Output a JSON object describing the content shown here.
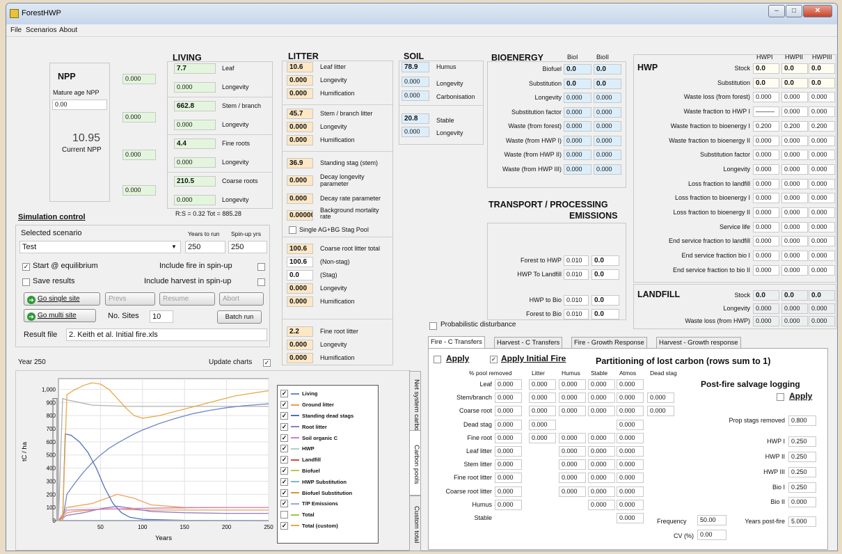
{
  "window": {
    "title": "ForestHWP",
    "min": "–",
    "max": "□",
    "close": "✕"
  },
  "menu": [
    "File",
    "Scenarios",
    "About"
  ],
  "npp": {
    "heading": "NPP",
    "mature_label": "Mature age NPP",
    "mature_value": "0.00",
    "current_value": "10.95",
    "current_label": "Current NPP",
    "alloc": [
      "0.000",
      "0.000",
      "0.000",
      "0.000"
    ]
  },
  "living": {
    "heading": "LIVING",
    "rows": [
      {
        "value": "7.7",
        "label": "Leaf",
        "longevity": "0.000",
        "longevity_label": "Longevity"
      },
      {
        "value": "662.8",
        "label": "Stem / branch",
        "longevity": "0.000",
        "longevity_label": "Longevity"
      },
      {
        "value": "4.4",
        "label": "Fine roots",
        "longevity": "0.000",
        "longevity_label": "Longevity"
      },
      {
        "value": "210.5",
        "label": "Coarse roots",
        "longevity": "0.000",
        "longevity_label": "Longevity"
      }
    ],
    "footer": "R:S = 0.32  Tot = 885.28"
  },
  "litter": {
    "heading": "LITTER",
    "leaf": {
      "value": "10.6",
      "label": "Leaf litter",
      "longevity": "0.000",
      "longevity_label": "Longevity",
      "humification": "0.000",
      "humification_label": "Humification"
    },
    "stem": {
      "value": "45.7",
      "label": "Stem / branch litter",
      "longevity": "0.000",
      "longevity_label": "Longevity",
      "humification": "0.000",
      "humification_label": "Humification"
    },
    "stag": {
      "value": "36.9",
      "label": "Standing stag (stem)",
      "decay_longevity": "0.000",
      "decay_longevity_label": "Decay longevity parameter",
      "decay_rate": "0.000",
      "decay_rate_label": "Decay rate parameter",
      "background": "0.00000",
      "background_label": "Background mortality rate",
      "single_pool_label": "Single AG+BG Stag Pool"
    },
    "coarse": {
      "total": "100.6",
      "total_label": "Coarse root litter total",
      "nonstag": "100.6",
      "nonstag_label": "(Non-stag)",
      "stag": "0.0",
      "stag_label": "(Stag)",
      "longevity": "0.000",
      "longevity_label": "Longevity",
      "humification": "0.000",
      "humification_label": "Humification"
    },
    "fine": {
      "value": "2.2",
      "label": "Fine root litter",
      "longevity": "0.000",
      "longevity_label": "Longevity",
      "humification": "0.000",
      "humification_label": "Humification"
    }
  },
  "soil": {
    "heading": "SOIL",
    "humus": {
      "value": "78.9",
      "label": "Humus",
      "longevity": "0.000",
      "longevity_label": "Longevity",
      "carbonisation": "0.000",
      "carbonisation_label": "Carbonisation"
    },
    "stable": {
      "value": "20.8",
      "label": "Stable",
      "longevity": "0.000",
      "longevity_label": "Longevity"
    }
  },
  "bioenergy": {
    "heading": "BIOENERGY",
    "col1": "BioI",
    "col2": "BioII",
    "rows": [
      {
        "label": "Biofuel",
        "a": "0.0",
        "b": "0.0"
      },
      {
        "label": "Substitution",
        "a": "0.0",
        "b": "0.0"
      },
      {
        "label": "Longevity",
        "a": "0.000",
        "b": "0.000"
      },
      {
        "label": "Substitution factor",
        "a": "0.000",
        "b": "0.000"
      },
      {
        "label": "Waste (from forest)",
        "a": "0.000",
        "b": "0.000"
      },
      {
        "label": "Waste (from HWP I)",
        "a": "0.000",
        "b": "0.000"
      },
      {
        "label": "Waste (from HWP II)",
        "a": "0.000",
        "b": "0.000"
      },
      {
        "label": "Waste (from HWP III)",
        "a": "0.000",
        "b": "0.000"
      }
    ]
  },
  "transport": {
    "heading1": "TRANSPORT / PROCESSING",
    "heading2": "EMISSIONS",
    "rows": [
      {
        "label": "Forest to HWP",
        "a": "0.010",
        "b": "0.0"
      },
      {
        "label": "HWP To Landfill",
        "a": "0.010",
        "b": "0.0"
      },
      {
        "label": "HWP to Bio",
        "a": "0.010",
        "b": "0.0"
      },
      {
        "label": "Forest to Bio",
        "a": "0.010",
        "b": "0.0"
      }
    ]
  },
  "hwp": {
    "heading": "HWP",
    "cols": [
      "HWPI",
      "HWPII",
      "HWPIII"
    ],
    "rows": [
      {
        "label": "Stock",
        "v": [
          "0.0",
          "0.0",
          "0.0"
        ]
      },
      {
        "label": "Substitution",
        "v": [
          "0.0",
          "0.0",
          "0.0"
        ]
      },
      {
        "label": "Waste loss (from forest)",
        "v": [
          "0.000",
          "0.000",
          "0.000"
        ]
      },
      {
        "label": "Waste fraction to HWP I",
        "v": [
          "———",
          "0.000",
          "0.000"
        ]
      },
      {
        "label": "Waste fraction to bioenergy I",
        "v": [
          "0.200",
          "0.200",
          "0.200"
        ]
      },
      {
        "label": "Waste fraction to bioenergy II",
        "v": [
          "0.000",
          "0.000",
          "0.000"
        ]
      },
      {
        "label": "Substitution factor",
        "v": [
          "0.000",
          "0.000",
          "0.000"
        ]
      },
      {
        "label": "Longevity",
        "v": [
          "0.000",
          "0.000",
          "0.000"
        ]
      },
      {
        "label": "Loss fraction to landfill",
        "v": [
          "0.000",
          "0.000",
          "0.000"
        ]
      },
      {
        "label": "Loss fraction to bioenergy I",
        "v": [
          "0.000",
          "0.000",
          "0.000"
        ]
      },
      {
        "label": "Loss fraction to bioenergy II",
        "v": [
          "0.000",
          "0.000",
          "0.000"
        ]
      },
      {
        "label": "Service life",
        "v": [
          "0.000",
          "0.000",
          "0.000"
        ]
      },
      {
        "label": "End service fraction to landfill",
        "v": [
          "0.000",
          "0.000",
          "0.000"
        ]
      },
      {
        "label": "End service fraction bio I",
        "v": [
          "0.000",
          "0.000",
          "0.000"
        ]
      },
      {
        "label": "End service fraction to bio II",
        "v": [
          "0.000",
          "0.000",
          "0.000"
        ]
      }
    ]
  },
  "landfill": {
    "heading": "LANDFILL",
    "rows": [
      {
        "label": "Stock",
        "v": [
          "0.0",
          "0.0",
          "0.0"
        ]
      },
      {
        "label": "Longevity",
        "v": [
          "0.000",
          "0.000",
          "0.000"
        ]
      },
      {
        "label": "Waste loss (from HWP)",
        "v": [
          "0.000",
          "0.000",
          "0.000"
        ]
      }
    ]
  },
  "sim": {
    "heading": "Simulation control",
    "scenario_label": "Selected scenario",
    "years_label": "Years to run",
    "spinup_label": "Spin-up yrs",
    "scenario": "Test",
    "years": "250",
    "spinup": "250",
    "start_eq": "Start @ equilibrium",
    "fire_spin": "Include fire in spin-up",
    "save": "Save results",
    "harvest_spin": "Include harvest in spin-up",
    "go_single": "Go single site",
    "prev": "Prevs",
    "resume": "Resume",
    "abort": "Abort",
    "go_multi": "Go multi site",
    "no_sites_label": "No. Sites",
    "no_sites": "10",
    "batch": "Batch run",
    "result_label": "Result file",
    "result_file": "2. Keith et al. Initial fire.xls",
    "year": "Year 250",
    "update_charts": "Update charts"
  },
  "chart_data": {
    "type": "line",
    "xlabel": "Years",
    "ylabel": "tC / ha",
    "xlim": [
      0,
      250
    ],
    "ylim": [
      0,
      1050
    ],
    "xticks": [
      50,
      100,
      150,
      200,
      250
    ],
    "yticks": [
      0,
      100,
      200,
      300,
      400,
      500,
      600,
      700,
      800,
      900,
      1000
    ],
    "ytick_labels": [
      "0",
      "100",
      "200",
      "300",
      "400",
      "500",
      "600",
      "700",
      "800",
      "900",
      "1,000"
    ],
    "series": [
      {
        "name": "Living",
        "color": "#6f86c8",
        "checked": true,
        "x": [
          0,
          5,
          10,
          20,
          30,
          40,
          50,
          60,
          70,
          80,
          90,
          100,
          120,
          140,
          160,
          180,
          200,
          220,
          250
        ],
        "y": [
          0,
          0,
          200,
          290,
          370,
          440,
          500,
          550,
          590,
          625,
          660,
          690,
          740,
          780,
          815,
          840,
          860,
          875,
          890
        ]
      },
      {
        "name": "Ground litter",
        "color": "#e6a050",
        "checked": true,
        "x": [
          0,
          10,
          20,
          40,
          60,
          80,
          100,
          150,
          200,
          250
        ],
        "y": [
          0,
          60,
          70,
          80,
          90,
          85,
          80,
          80,
          80,
          80
        ]
      },
      {
        "name": "Standing dead stags",
        "color": "#4e70b8",
        "checked": true,
        "x": [
          0,
          5,
          8,
          15,
          25,
          35,
          45,
          55,
          65,
          75,
          85,
          100,
          150,
          250
        ],
        "y": [
          0,
          0,
          660,
          650,
          600,
          520,
          400,
          250,
          130,
          60,
          25,
          10,
          2,
          0
        ]
      },
      {
        "name": "Root litter",
        "color": "#8a7dc8",
        "checked": true,
        "x": [
          0,
          10,
          30,
          50,
          70,
          90,
          110,
          150,
          200,
          250
        ],
        "y": [
          0,
          40,
          60,
          90,
          110,
          90,
          70,
          60,
          55,
          55
        ]
      },
      {
        "name": "Soil organic C",
        "color": "#d47ac0",
        "checked": true,
        "x": [
          0,
          10,
          40,
          80,
          120,
          160,
          200,
          250
        ],
        "y": [
          0,
          80,
          85,
          90,
          95,
          98,
          100,
          100
        ]
      },
      {
        "name": "HWP",
        "color": "#a9d0c8",
        "checked": true,
        "x": [
          0,
          250
        ],
        "y": [
          0,
          0
        ]
      },
      {
        "name": "Landfill",
        "color": "#c8503c",
        "checked": true,
        "x": [
          0,
          250
        ],
        "y": [
          0,
          0
        ]
      },
      {
        "name": "Biofuel",
        "color": "#b8c850",
        "checked": true,
        "x": [
          0,
          250
        ],
        "y": [
          0,
          0
        ]
      },
      {
        "name": "HWP Substitution",
        "color": "#7ab8d0",
        "checked": true,
        "x": [
          0,
          250
        ],
        "y": [
          0,
          0
        ]
      },
      {
        "name": "Biofuel Substitution",
        "color": "#d09840",
        "checked": true,
        "x": [
          0,
          250
        ],
        "y": [
          0,
          0
        ]
      },
      {
        "name": "T/P Emissions",
        "color": "#98a8d8",
        "checked": true,
        "x": [
          0,
          250
        ],
        "y": [
          0,
          0
        ]
      },
      {
        "name": "Total",
        "color": "#9cc840",
        "checked": false,
        "x": [],
        "y": []
      },
      {
        "name": "Total (custom)",
        "color": "#e8a848",
        "checked": true,
        "x": [
          0,
          5,
          10,
          20,
          30,
          40,
          50,
          60,
          70,
          80,
          90,
          100,
          120,
          150,
          180,
          210,
          250
        ],
        "y": [
          0,
          0,
          960,
          1000,
          1030,
          1050,
          1040,
          1000,
          930,
          860,
          800,
          780,
          800,
          850,
          900,
          950,
          990
        ]
      }
    ],
    "extra_lines": [
      {
        "color": "#f0a060",
        "x": [
          0,
          10,
          40,
          70,
          90,
          110,
          150,
          250
        ],
        "y": [
          0,
          100,
          130,
          200,
          170,
          120,
          100,
          100
        ]
      },
      {
        "color": "#b0b0b0",
        "x": [
          0,
          5,
          10,
          40,
          80,
          120,
          250
        ],
        "y": [
          0,
          930,
          920,
          880,
          870,
          870,
          870
        ]
      }
    ]
  },
  "side_tabs": [
    "Net system carbon balance",
    "Carbon pools",
    "Custom total"
  ],
  "prob_dist": "Probabilistic disturbance",
  "tabs": [
    "Fire - C Transfers",
    "Harvest - C Transfers",
    "Fire - Growth Response",
    "Harvest - Growth response"
  ],
  "fire": {
    "apply": "Apply",
    "apply_initial": "Apply Initial Fire",
    "partition_heading": "Partitioning of lost carbon (rows sum to 1)",
    "cols": [
      "% pool removed",
      "Litter",
      "Humus",
      "Stable",
      "Atmos",
      "Dead stag"
    ],
    "rows": [
      {
        "label": "Leaf",
        "v": [
          "0.000",
          "0.000",
          "0.000",
          "0.000",
          "0.000",
          ""
        ]
      },
      {
        "label": "Stem/branch",
        "v": [
          "0.000",
          "0.000",
          "0.000",
          "0.000",
          "0.000",
          "0.000"
        ]
      },
      {
        "label": "Coarse root",
        "v": [
          "0.000",
          "0.000",
          "0.000",
          "0.000",
          "0.000",
          "0.000"
        ]
      },
      {
        "label": "Dead stag",
        "v": [
          "0.000",
          "0.000",
          "",
          "",
          "0.000",
          ""
        ]
      },
      {
        "label": "Fine root",
        "v": [
          "0.000",
          "0.000",
          "0.000",
          "0.000",
          "0.000",
          ""
        ]
      },
      {
        "label": "Leaf litter",
        "v": [
          "0.000",
          "",
          "0.000",
          "0.000",
          "0.000",
          ""
        ]
      },
      {
        "label": "Stem litter",
        "v": [
          "0.000",
          "",
          "0.000",
          "0.000",
          "0.000",
          ""
        ]
      },
      {
        "label": "Fine root litter",
        "v": [
          "0.000",
          "",
          "0.000",
          "0.000",
          "0.000",
          ""
        ]
      },
      {
        "label": "Coarse root litter",
        "v": [
          "0.000",
          "",
          "0.000",
          "0.000",
          "0.000",
          ""
        ]
      },
      {
        "label": "Humus",
        "v": [
          "0.000",
          "",
          "",
          "0.000",
          "0.000",
          ""
        ]
      },
      {
        "label": "Stable",
        "v": [
          "",
          "",
          "",
          "",
          "0.000",
          ""
        ]
      }
    ],
    "frequency_label": "Frequency",
    "frequency": "50.00",
    "cv_label": "CV (%)",
    "cv": "0.00",
    "salvage_heading": "Post-fire salvage logging",
    "salvage_apply": "Apply",
    "salvage_rows": [
      {
        "label": "Prop stags removed",
        "v": "0.800"
      },
      {
        "label": "HWP I",
        "v": "0.250"
      },
      {
        "label": "HWP II",
        "v": "0.250"
      },
      {
        "label": "HWP III",
        "v": "0.250"
      },
      {
        "label": "Bio I",
        "v": "0.250"
      },
      {
        "label": "Bio II",
        "v": "0.000"
      },
      {
        "label": "Years post-fire",
        "v": "5.000"
      }
    ]
  }
}
